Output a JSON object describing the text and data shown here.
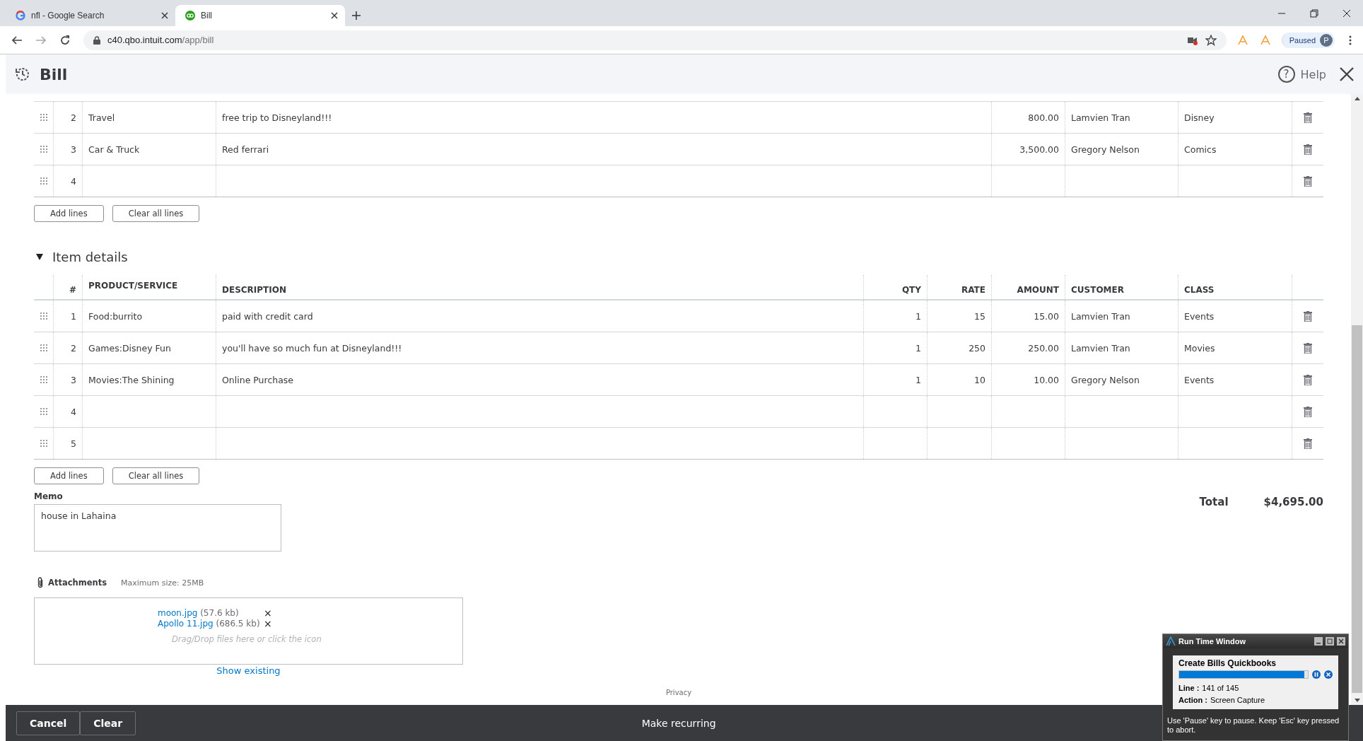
{
  "browser": {
    "tabs": [
      {
        "title": "nfl - Google Search",
        "kind": "google",
        "selected": false
      },
      {
        "title": "Bill",
        "kind": "quickbooks",
        "selected": true
      }
    ],
    "url_host": "c40.qbo.intuit.com",
    "url_path": "/app/bill",
    "profile_label": "Paused",
    "avatar_letter": "P"
  },
  "app": {
    "title": "Bill",
    "help_glyph": "?",
    "help_label": "Help"
  },
  "category_details": {
    "rows": [
      {
        "num": "2",
        "cells": [
          "Travel",
          "free trip to Disneyland!!!",
          "800.00",
          "Lamvien Tran",
          "Disney"
        ]
      },
      {
        "num": "3",
        "cells": [
          "Car & Truck",
          "Red ferrari",
          "3,500.00",
          "Gregory Nelson",
          "Comics"
        ]
      },
      {
        "num": "4"
      }
    ],
    "buttons": [
      "Add lines",
      "Clear all lines"
    ]
  },
  "item_details": {
    "title": "Item details",
    "expanded": true,
    "columns": [
      "#",
      "PRODUCT/SERVICE",
      "DESCRIPTION",
      "QTY",
      "RATE",
      "AMOUNT",
      "CUSTOMER",
      "CLASS"
    ],
    "rows": [
      {
        "num": "1",
        "cells": [
          "Food:burrito",
          "paid with credit card",
          "1",
          "15",
          "15.00",
          "Lamvien Tran",
          "Events"
        ]
      },
      {
        "num": "2",
        "cells": [
          "Games:Disney Fun",
          "you'll have so much fun at Disneyland!!!",
          "1",
          "250",
          "250.00",
          "Lamvien Tran",
          "Movies"
        ]
      },
      {
        "num": "3",
        "cells": [
          "Movies:The Shining",
          "Online Purchase",
          "1",
          "10",
          "10.00",
          "Gregory Nelson",
          "Events"
        ]
      },
      {
        "num": "4"
      },
      {
        "num": "5"
      }
    ],
    "buttons": [
      "Add lines",
      "Clear all lines"
    ]
  },
  "memo": {
    "label": "Memo",
    "value": "house in Lahaina"
  },
  "total": {
    "label": "Total",
    "value": "$4,695.00"
  },
  "attachments": {
    "label": "Attachments",
    "max_size": "Maximum size: 25MB",
    "files": [
      {
        "name": "moon.jpg",
        "size": "(57.6 kb)"
      },
      {
        "name": "Apollo 11.jpg",
        "size": "(686.5 kb)"
      }
    ],
    "remove_glyph": "×",
    "hint": "Drag/Drop files here or click the icon",
    "show_existing": "Show existing"
  },
  "privacy": "Privacy",
  "footer": {
    "cancel": "Cancel",
    "clear": "Clear",
    "make_recurring": "Make recurring"
  },
  "runtime_window": {
    "title": "Run Time Window",
    "job": "Create Bills Quickbooks",
    "level": 0.97,
    "line_label": "Line :",
    "line_value": "141 of 145",
    "action_label": "Action :",
    "action_value": "Screen Capture",
    "hint": "Use 'Pause' key to pause. Keep 'Esc' key pressed to abort."
  }
}
